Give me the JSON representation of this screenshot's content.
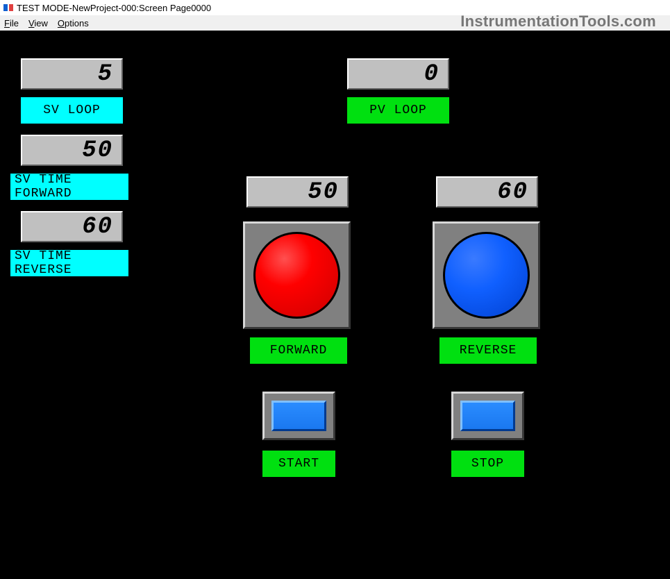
{
  "window": {
    "title": "TEST MODE-NewProject-000:Screen Page0000"
  },
  "menu": {
    "file": "File",
    "view": "View",
    "options": "Options"
  },
  "watermark": "InstrumentationTools.com",
  "left_panel": {
    "sv_loop_value": "5",
    "sv_loop_label": "SV LOOP",
    "sv_fwd_value": "50",
    "sv_fwd_label": "SV TIME FORWARD",
    "sv_rev_value": "60",
    "sv_rev_label": "SV TIME REVERSE"
  },
  "pv": {
    "value": "0",
    "label": "PV LOOP"
  },
  "forward": {
    "value": "50",
    "label": "FORWARD"
  },
  "reverse": {
    "value": "60",
    "label": "REVERSE"
  },
  "start_label": "START",
  "stop_label": "STOP"
}
